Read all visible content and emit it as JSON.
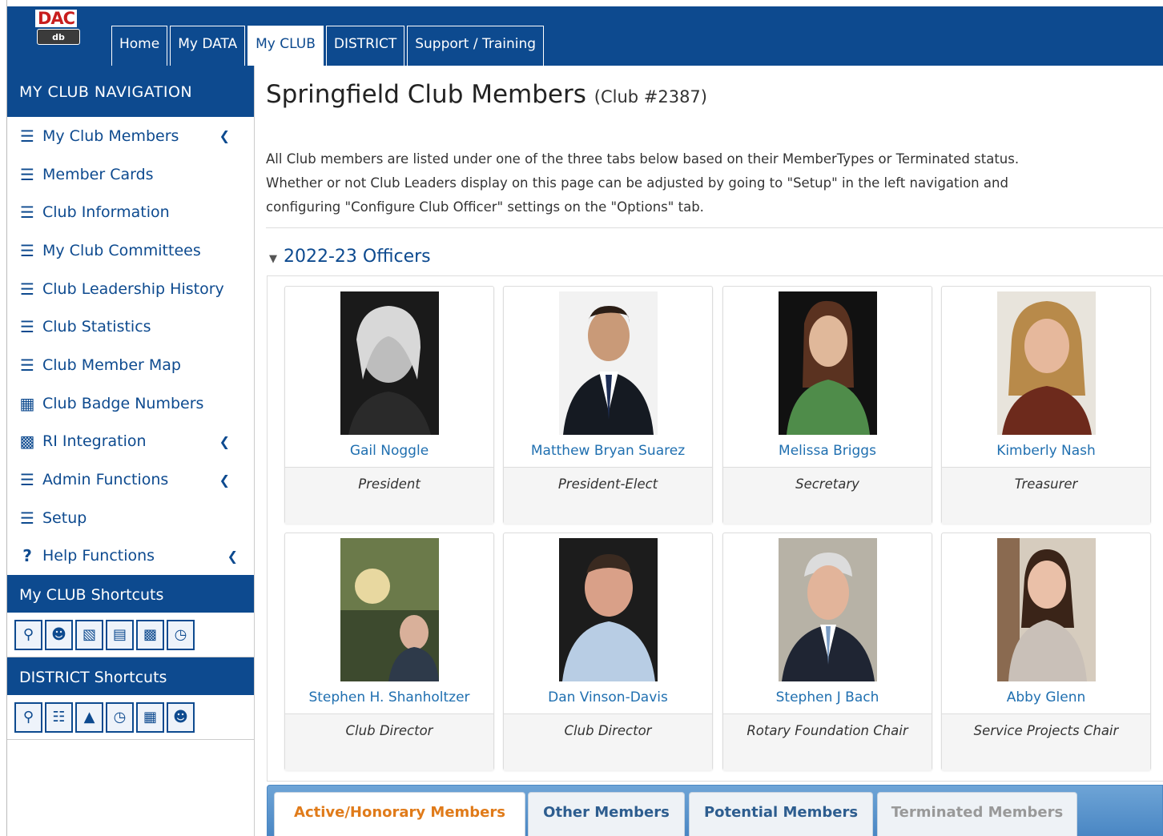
{
  "app": {
    "logo_text": "DAC",
    "logo_sub": "db"
  },
  "top_nav": {
    "tabs": [
      {
        "label": "Home"
      },
      {
        "label": "My DATA"
      },
      {
        "label": "My CLUB"
      },
      {
        "label": "DISTRICT"
      },
      {
        "label": "Support / Training"
      }
    ],
    "active_tab": "My CLUB"
  },
  "sidebar": {
    "header": "MY CLUB NAVIGATION",
    "items": [
      {
        "label": "My Club Members",
        "icon": "menu-icon",
        "expandable": true
      },
      {
        "label": "Member Cards",
        "icon": "list-icon"
      },
      {
        "label": "Club Information",
        "icon": "list-icon"
      },
      {
        "label": "My Club Committees",
        "icon": "list-icon"
      },
      {
        "label": "Club Leadership History",
        "icon": "list-icon"
      },
      {
        "label": "Club Statistics",
        "icon": "list-icon"
      },
      {
        "label": "Club Member Map",
        "icon": "list-icon"
      },
      {
        "label": "Club Badge Numbers",
        "icon": "badge-icon"
      },
      {
        "label": "RI Integration",
        "icon": "table-icon",
        "expandable": true
      },
      {
        "label": "Admin Functions",
        "icon": "menu-icon",
        "expandable": true
      },
      {
        "label": "Setup",
        "icon": "list-icon"
      },
      {
        "label": "Help Functions",
        "icon": "question-icon",
        "expandable": true
      }
    ],
    "club_shortcuts_header": "My CLUB Shortcuts",
    "district_shortcuts_header": "DISTRICT Shortcuts"
  },
  "main": {
    "title": "Springfield Club Members",
    "title_sub": "(Club #2387)",
    "intro": "All Club members are listed under one of the three tabs below based on their MemberTypes or Terminated status. Whether or not Club Leaders display on this page can be adjusted by going to \"Setup\" in the left navigation and configuring \"Configure Club Officer\" settings on the \"Options\" tab.",
    "officers_section": "2022-23 Officers",
    "officers": [
      {
        "name": "Gail Noggle",
        "role": "President"
      },
      {
        "name": "Matthew Bryan Suarez",
        "role": "President-Elect"
      },
      {
        "name": "Melissa Briggs",
        "role": "Secretary"
      },
      {
        "name": "Kimberly Nash",
        "role": "Treasurer"
      },
      {
        "name": "Stephen H. Shanholtzer",
        "role": "Club Director"
      },
      {
        "name": "Dan Vinson-Davis",
        "role": "Club Director"
      },
      {
        "name": "Stephen J Bach",
        "role": "Rotary Foundation Chair"
      },
      {
        "name": "Abby Glenn",
        "role": "Service Projects Chair"
      }
    ],
    "member_tabs": [
      {
        "label": "Active/Honorary Members"
      },
      {
        "label": "Other Members"
      },
      {
        "label": "Potential Members"
      },
      {
        "label": "Terminated Members"
      }
    ]
  },
  "colors": {
    "brand_blue": "#0d4a8f",
    "link_blue": "#1f6fb0",
    "active_tab_orange": "#e07b1a"
  }
}
